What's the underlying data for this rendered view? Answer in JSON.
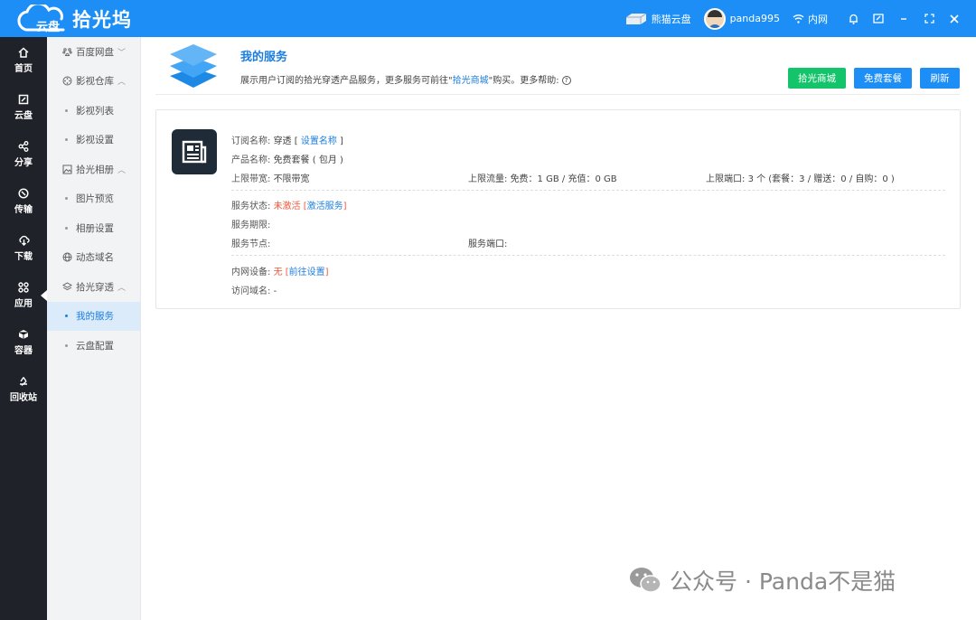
{
  "app": {
    "logo_small": "云盘",
    "logo_name": "拾光坞"
  },
  "topbar": {
    "device": "熊猫云盘",
    "user": "panda995",
    "network": "内网"
  },
  "rail": [
    {
      "label": "首页"
    },
    {
      "label": "云盘"
    },
    {
      "label": "分享"
    },
    {
      "label": "传输"
    },
    {
      "label": "下载"
    },
    {
      "label": "应用"
    },
    {
      "label": "容器"
    },
    {
      "label": "回收站"
    }
  ],
  "sidebar": {
    "items": [
      {
        "label": "百度网盘"
      },
      {
        "label": "影视仓库"
      },
      {
        "label": "影视列表"
      },
      {
        "label": "影视设置"
      },
      {
        "label": "拾光相册"
      },
      {
        "label": "图片预览"
      },
      {
        "label": "相册设置"
      },
      {
        "label": "动态域名"
      },
      {
        "label": "拾光穿透"
      },
      {
        "label": "我的服务"
      },
      {
        "label": "云盘配置"
      }
    ]
  },
  "header": {
    "title": "我的服务",
    "desc_before": "展示用户订阅的拾光穿透产品服务，更多服务可前往\"",
    "desc_link": "拾光商城",
    "desc_after": "\"购买。更多帮助:",
    "help_glyph": "?",
    "btn_shop": "拾光商城",
    "btn_free": "免费套餐",
    "btn_refresh": "刷新"
  },
  "card": {
    "sub_name_label": "订阅名称:",
    "sub_name_value": "穿透 [",
    "sub_name_link": "设置名称",
    "sub_name_close": "]",
    "product_label": "产品名称:",
    "product_value": "免费套餐 ( 包月 )",
    "bw_label": "上限带宽:",
    "bw_value": "不限带宽",
    "traffic_label": "上限流量:",
    "traffic_value": "免费：1 GB / 充值：0 GB",
    "ports_label": "上限端口:",
    "ports_value": "3 个 (套餐：3 / 赠送：0 / 自购：0 )",
    "status_label": "服务状态:",
    "status_value": "未激活",
    "status_open": "[",
    "status_link": "激活服务",
    "status_close": "]",
    "period_label": "服务期限:",
    "node_label": "服务节点:",
    "port_label": "服务端口:",
    "lan_label": "内网设备:",
    "lan_value": "无",
    "lan_open": "[",
    "lan_link": "前往设置",
    "lan_close": "]",
    "domain_label": "访问域名:",
    "domain_value": "-"
  },
  "watermark": "公众号 · Panda不是猫",
  "colors": {
    "accent": "#1c8ef5",
    "green": "#14c46b",
    "warn": "#f0573a",
    "rail": "#1f2228"
  }
}
